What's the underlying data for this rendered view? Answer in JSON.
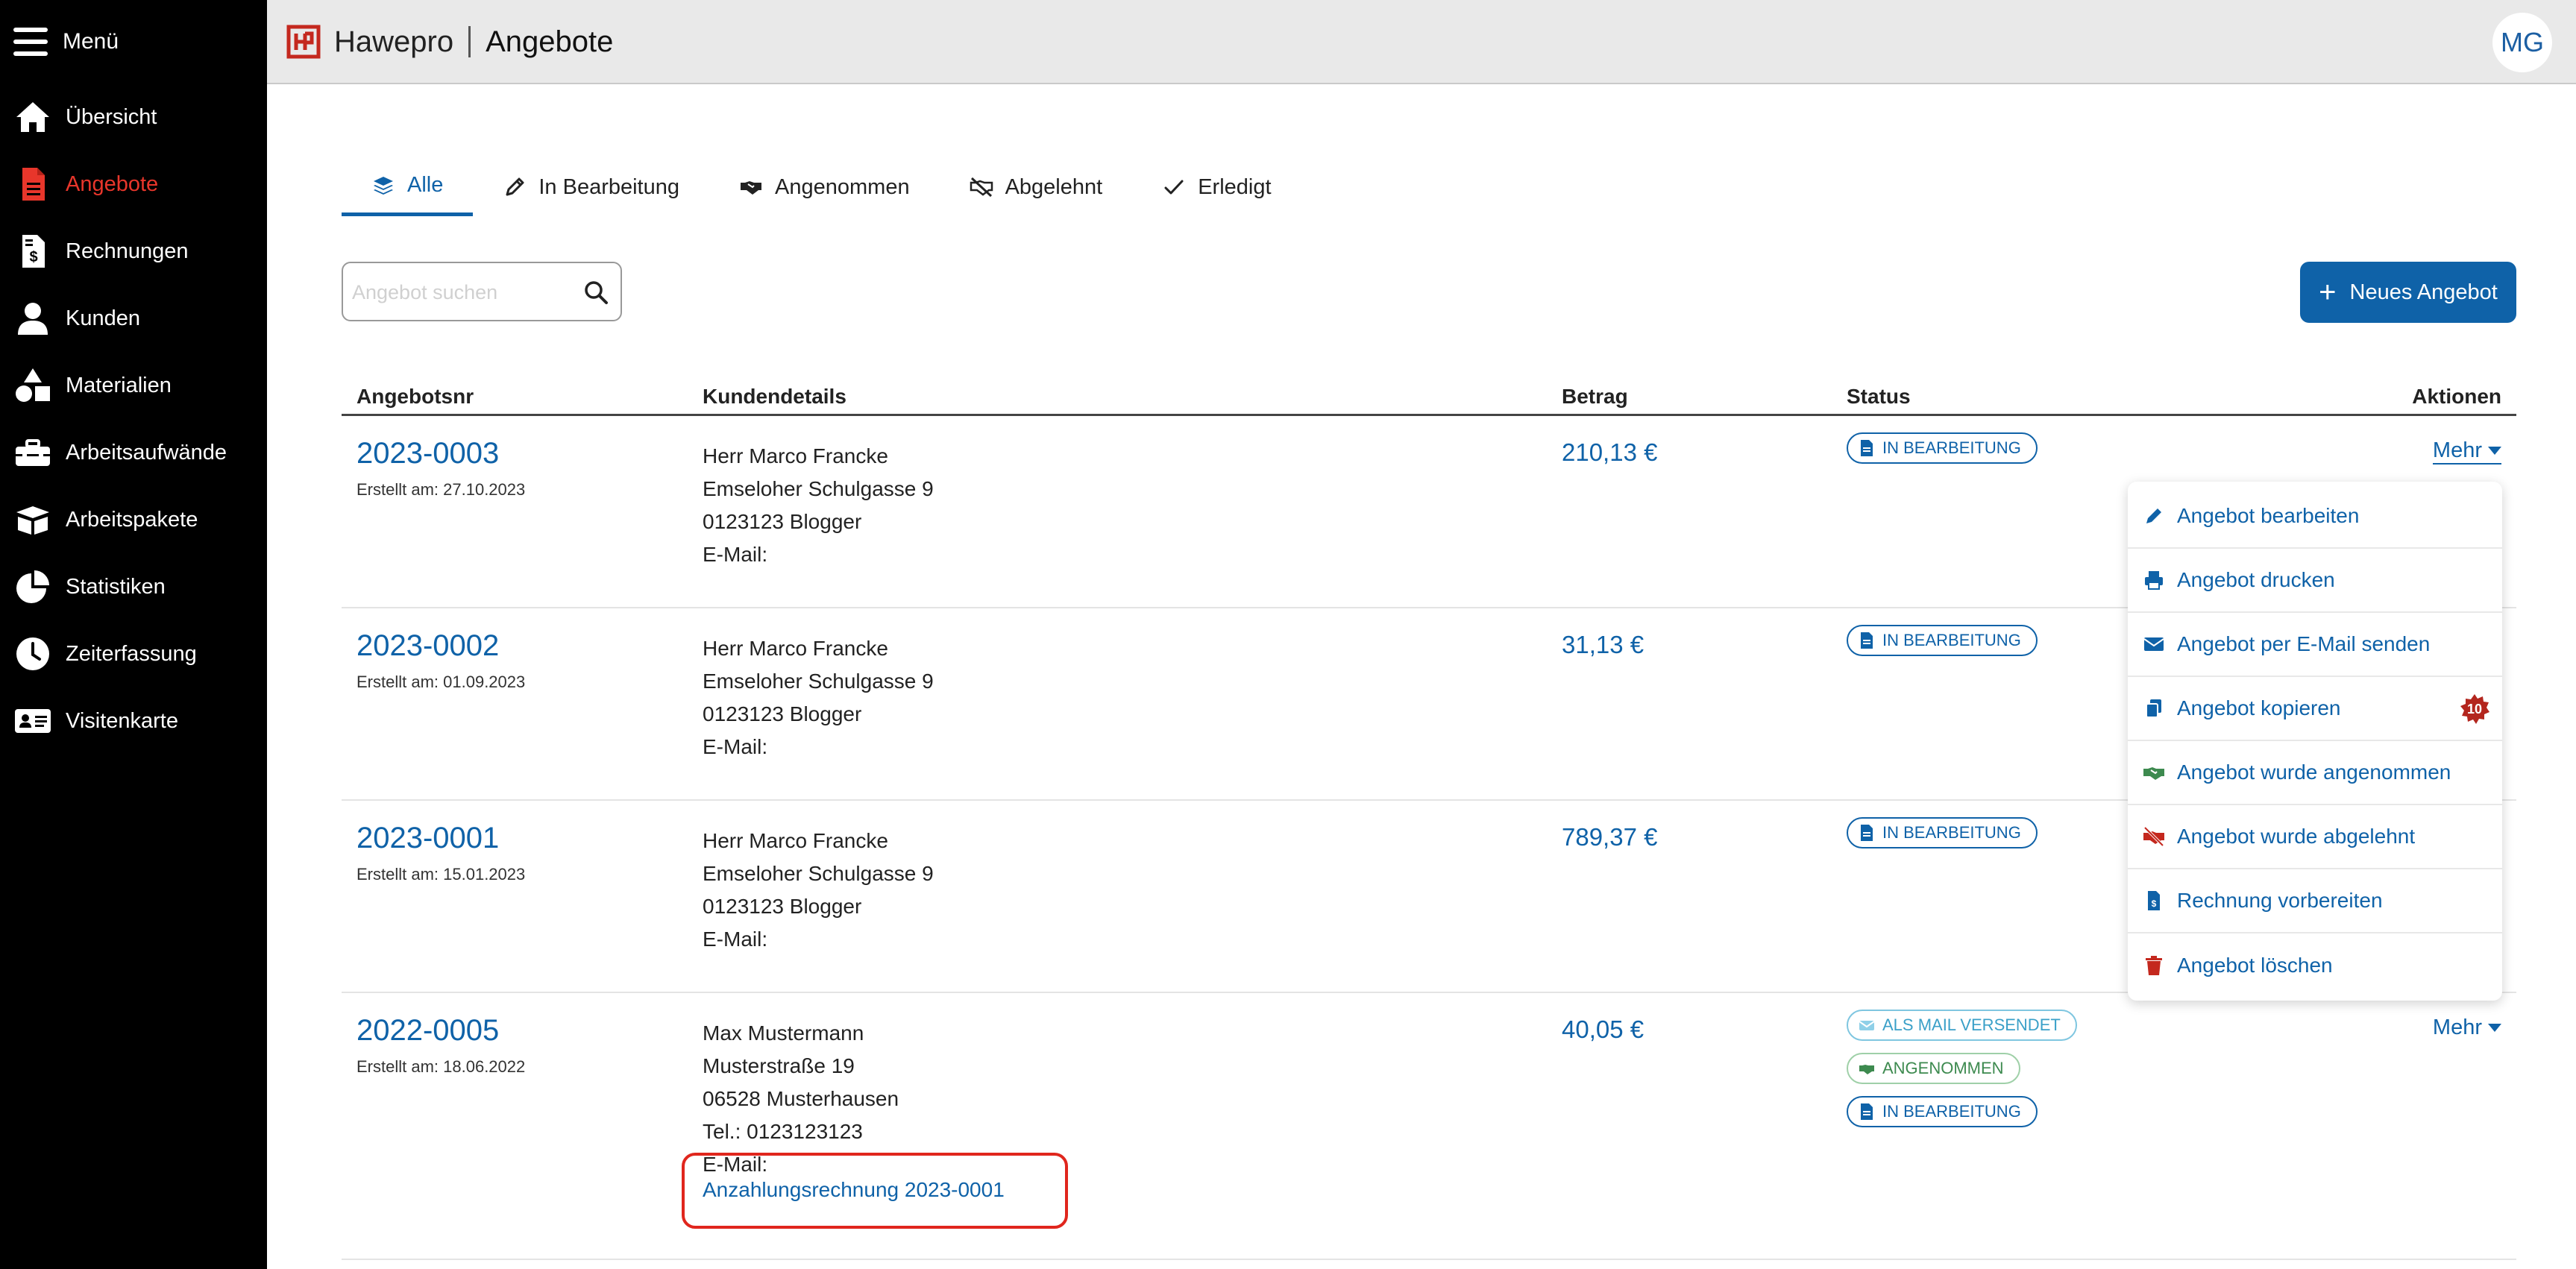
{
  "sidebar": {
    "menu_label": "Menü",
    "items": [
      {
        "label": "Übersicht",
        "icon": "home-icon"
      },
      {
        "label": "Angebote",
        "icon": "document-icon",
        "active": true
      },
      {
        "label": "Rechnungen",
        "icon": "invoice-icon"
      },
      {
        "label": "Kunden",
        "icon": "user-icon"
      },
      {
        "label": "Materialien",
        "icon": "shapes-icon"
      },
      {
        "label": "Arbeitsaufwände",
        "icon": "toolbox-icon"
      },
      {
        "label": "Arbeitspakete",
        "icon": "box-icon"
      },
      {
        "label": "Statistiken",
        "icon": "pie-chart-icon"
      },
      {
        "label": "Zeiterfassung",
        "icon": "clock-icon"
      },
      {
        "label": "Visitenkarte",
        "icon": "id-card-icon"
      }
    ]
  },
  "header": {
    "brand": "Hawepro",
    "page": "Angebote",
    "user_initials": "MG"
  },
  "tabs": [
    {
      "label": "Alle",
      "icon": "layers-icon",
      "active": true
    },
    {
      "label": "In Bearbeitung",
      "icon": "pencil-icon"
    },
    {
      "label": "Angenommen",
      "icon": "handshake-icon"
    },
    {
      "label": "Abgelehnt",
      "icon": "handshake-slash-icon"
    },
    {
      "label": "Erledigt",
      "icon": "check-icon"
    }
  ],
  "search": {
    "placeholder": "Angebot suchen",
    "value": ""
  },
  "new_offer_button": "Neues Angebot",
  "table": {
    "headers": {
      "number": "Angebotsnr",
      "customer": "Kundendetails",
      "amount": "Betrag",
      "status": "Status",
      "actions": "Aktionen"
    },
    "rows": [
      {
        "number": "2023-0003",
        "created": "Erstellt am: 27.10.2023",
        "customer": [
          "Herr Marco Francke",
          "Emseloher Schulgasse 9",
          "0123123 Blogger",
          "E-Mail:"
        ],
        "amount": "210,13 €",
        "statuses": [
          "IN BEARBEITUNG"
        ],
        "action": "Mehr"
      },
      {
        "number": "2023-0002",
        "created": "Erstellt am: 01.09.2023",
        "customer": [
          "Herr Marco Francke",
          "Emseloher Schulgasse 9",
          "0123123 Blogger",
          "E-Mail:"
        ],
        "amount": "31,13 €",
        "statuses": [
          "IN BEARBEITUNG"
        ]
      },
      {
        "number": "2023-0001",
        "created": "Erstellt am: 15.01.2023",
        "customer": [
          "Herr Marco Francke",
          "Emseloher Schulgasse 9",
          "0123123 Blogger",
          "E-Mail:"
        ],
        "amount": "789,37 €",
        "statuses": [
          "IN BEARBEITUNG"
        ]
      },
      {
        "number": "2022-0005",
        "created": "Erstellt am: 18.06.2022",
        "customer": [
          "Max Mustermann",
          "Musterstraße 19",
          "06528 Musterhausen",
          "Tel.: 0123123123",
          "E-Mail:"
        ],
        "linked_invoice": "Anzahlungsrechnung 2023-0001",
        "amount": "40,05 €",
        "statuses": [
          "ALS MAIL VERSENDET",
          "ANGENOMMEN",
          "IN BEARBEITUNG"
        ],
        "action": "Mehr"
      }
    ]
  },
  "dropdown": {
    "items": [
      {
        "label": "Angebot bearbeiten",
        "icon": "pencil-icon"
      },
      {
        "label": "Angebot drucken",
        "icon": "printer-icon"
      },
      {
        "label": "Angebot per E-Mail senden",
        "icon": "envelope-icon"
      },
      {
        "label": "Angebot kopieren",
        "icon": "copy-icon",
        "count": "10"
      },
      {
        "label": "Angebot wurde angenommen",
        "icon": "handshake-icon"
      },
      {
        "label": "Angebot wurde abgelehnt",
        "icon": "handshake-slash-icon"
      },
      {
        "label": "Rechnung vorbereiten",
        "icon": "invoice-icon"
      },
      {
        "label": "Angebot löschen",
        "icon": "trash-icon"
      }
    ]
  },
  "colors": {
    "accent_blue": "#0f62a8",
    "active_red": "#e8362b",
    "highlight_red": "#e0261d",
    "sidebar_bg": "#000000"
  }
}
